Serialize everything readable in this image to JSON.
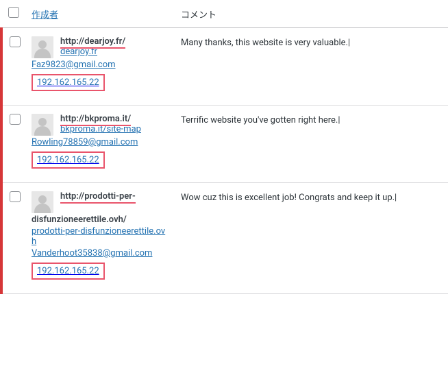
{
  "header": {
    "author_label": "作成者",
    "comment_label": "コメント"
  },
  "rows": [
    {
      "name": "http://dearjoy.fr/",
      "site": "dearjoy.fr",
      "email": "Faz9823@gmail.com",
      "ip": "192.162.165.22",
      "comment": "Many thanks, this website is very valuable.|"
    },
    {
      "name": "http://bkproma.it/",
      "site": "bkproma.it/site-map",
      "email": "Rowling78859@gmail.com",
      "ip": "192.162.165.22",
      "comment": "Terrific website you've gotten right here.|"
    },
    {
      "name": "http://prodotti-per-disfunzioneerettile.ovh/",
      "site": "prodotti-per-disfunzioneerettile.ovh",
      "email": "Vanderhoot35838@gmail.com",
      "ip": "192.162.165.22",
      "comment": "Wow cuz this is excellent job! Congrats and keep it up.|"
    }
  ]
}
